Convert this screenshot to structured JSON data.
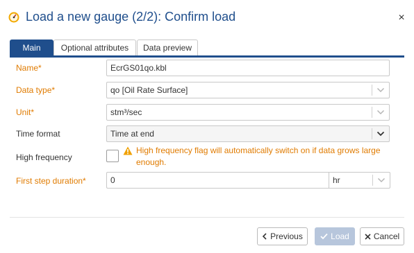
{
  "dialog": {
    "title": "Load a new gauge (2/2): Confirm load",
    "close_label": "×"
  },
  "tabs": [
    {
      "label": "Main",
      "active": true
    },
    {
      "label": "Optional attributes",
      "active": false
    },
    {
      "label": "Data preview",
      "active": false
    }
  ],
  "form": {
    "name_label": "Name",
    "name_value": "EcrGS01qo.kbl",
    "data_type_label": "Data type",
    "data_type_value": "qo [Oil Rate Surface]",
    "unit_label": "Unit",
    "unit_value": "stm³/sec",
    "time_format_label": "Time format",
    "time_format_value": "Time at end",
    "high_frequency_label": "High frequency",
    "high_frequency_checked": false,
    "high_frequency_warning": "High frequency flag will automatically switch on if data grows large enough.",
    "first_step_label": "First step duration",
    "first_step_value": "0",
    "first_step_unit": "hr",
    "required_marker": "*"
  },
  "footer": {
    "previous_label": "Previous",
    "load_label": "Load",
    "cancel_label": "Cancel"
  },
  "colors": {
    "accent": "#1f4e8c",
    "required": "#e07b00",
    "warning": "#e07b00",
    "load_disabled": "#b7c6dc"
  },
  "icons": {
    "title": "gauge-icon",
    "warning": "warning-triangle-icon",
    "previous": "chevron-left-icon",
    "load": "check-icon",
    "cancel": "x-icon",
    "dropdown": "chevron-down-icon"
  }
}
